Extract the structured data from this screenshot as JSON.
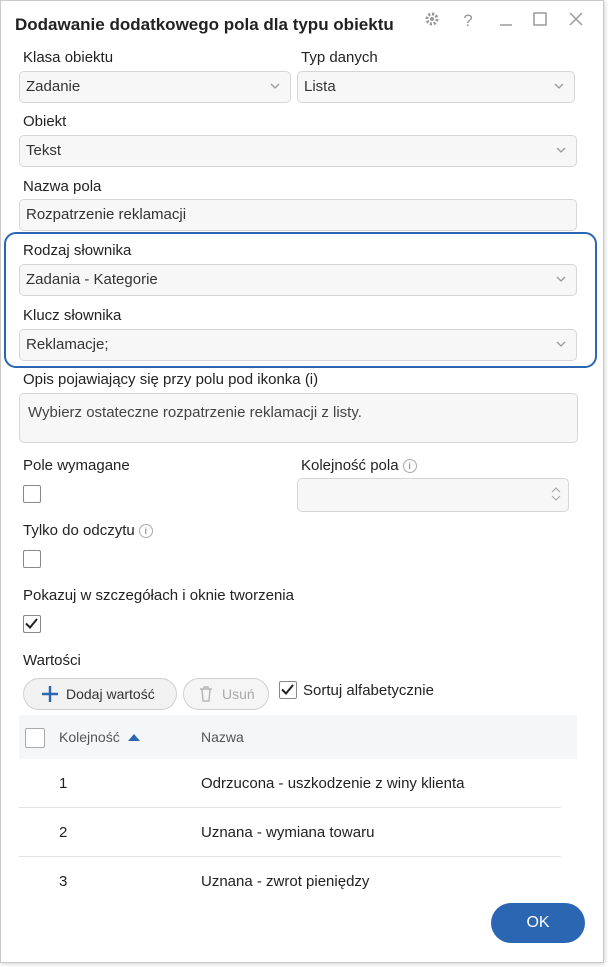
{
  "dialog": {
    "title": "Dodawanie dodatkowego pola dla typu obiektu",
    "icons": [
      "gear-icon",
      "help-icon",
      "minimize-icon",
      "maximize-icon",
      "close-icon"
    ]
  },
  "form": {
    "klasa_obiektu": {
      "label": "Klasa obiektu",
      "value": "Zadanie"
    },
    "typ_danych": {
      "label": "Typ danych",
      "value": "Lista"
    },
    "obiekt": {
      "label": "Obiekt",
      "value": "Tekst"
    },
    "nazwa_pola": {
      "label": "Nazwa pola",
      "value": "Rozpatrzenie reklamacji"
    },
    "rodzaj_slownika": {
      "label": "Rodzaj słownika",
      "value": "Zadania - Kategorie"
    },
    "klucz_slownika": {
      "label": "Klucz słownika",
      "value": "Reklamacje;"
    },
    "opis": {
      "label": "Opis pojawiający się przy polu pod ikonka (i)",
      "value": "Wybierz ostateczne rozpatrzenie reklamacji z listy."
    },
    "pole_wymagane": {
      "label": "Pole wymagane",
      "checked": false
    },
    "kolejnosc_pola": {
      "label": "Kolejność pola",
      "value": ""
    },
    "tylko_do_odczytu": {
      "label": "Tylko do odczytu",
      "checked": false
    },
    "pokazuj": {
      "label": "Pokazuj w szczegółach i oknie tworzenia",
      "checked": true
    }
  },
  "values_section": {
    "label": "Wartości",
    "add_button": "Dodaj wartość",
    "remove_button": "Usuń",
    "sort_label": "Sortuj alfabetycznie",
    "sort_checked": true,
    "columns": {
      "order": "Kolejność",
      "name": "Nazwa"
    },
    "rows": [
      {
        "order": "1",
        "name": "Odrzucona - uszkodzenie z winy klienta"
      },
      {
        "order": "2",
        "name": "Uznana - wymiana towaru"
      },
      {
        "order": "3",
        "name": "Uznana - zwrot pieniędzy"
      }
    ]
  },
  "footer": {
    "ok_label": "OK"
  },
  "colors": {
    "accent": "#2b66b3"
  }
}
